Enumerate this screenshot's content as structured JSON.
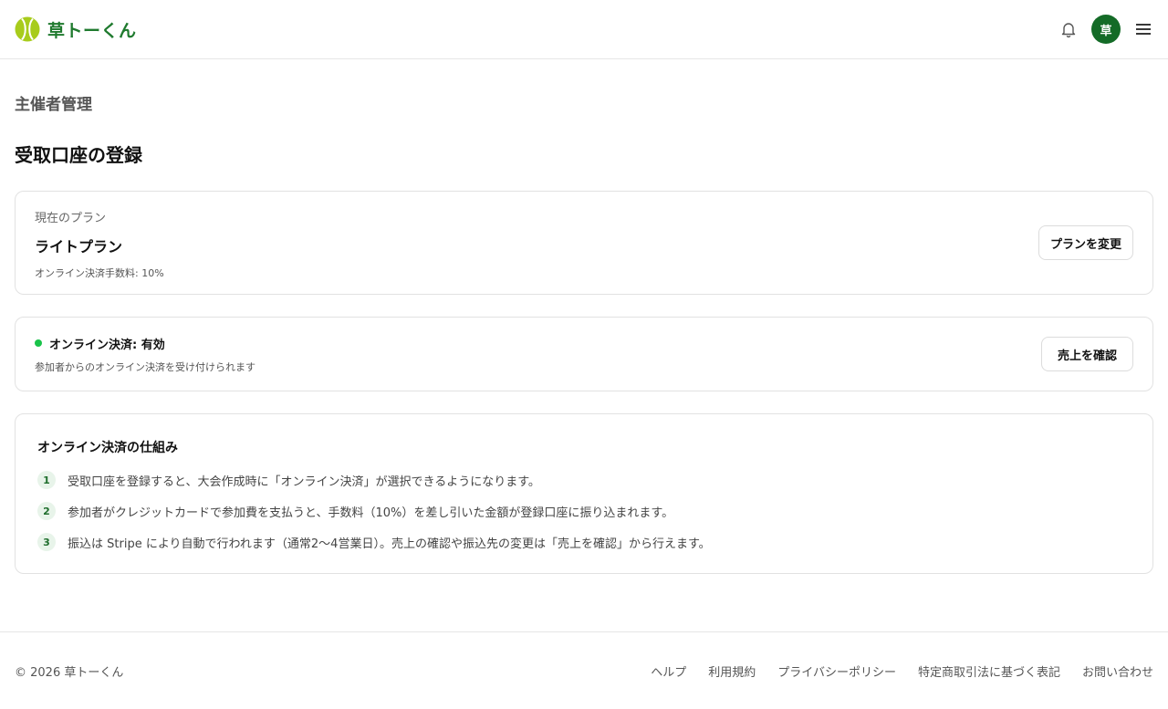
{
  "header": {
    "brand_name": "草トーくん",
    "avatar_initial": "草",
    "icons": [
      "tennis-ball-icon",
      "bell-icon",
      "hamburger-menu-icon"
    ]
  },
  "main": {
    "section_label": "主催者管理",
    "page_title": "受取口座の登録",
    "plan_card": {
      "caption": "現在のプラン",
      "plan_name": "ライトプラン",
      "fee_text": "オンライン決済手数料: 10%",
      "button_label": "プランを変更"
    },
    "status_card": {
      "title": "オンライン決済: 有効",
      "description": "参加者からのオンライン決済を受け付けられます",
      "button_label": "売上を確認",
      "status_color": "#19c34a"
    },
    "howto": {
      "title": "オンライン決済の仕組み",
      "steps": [
        {
          "num": "1",
          "text": "受取口座を登録すると、大会作成時に「オンライン決済」が選択できるようになります。"
        },
        {
          "num": "2",
          "text": "参加者がクレジットカードで参加費を支払うと、手数料（10%）を差し引いた金額が登録口座に振り込まれます。"
        },
        {
          "num": "3",
          "text": "振込は Stripe により自動で行われます（通常2〜4営業日）。売上の確認や振込先の変更は「売上を確認」から行えます。"
        }
      ]
    }
  },
  "footer": {
    "copyright": "© 2026 草トーくん",
    "links": [
      "ヘルプ",
      "利用規約",
      "プライバシーポリシー",
      "特定商取引法に基づく表記",
      "お問い合わせ"
    ]
  },
  "colors": {
    "brand_green": "#1f7a2e",
    "avatar_bg": "#146b27",
    "logo_ball": "#a8cc1c"
  }
}
